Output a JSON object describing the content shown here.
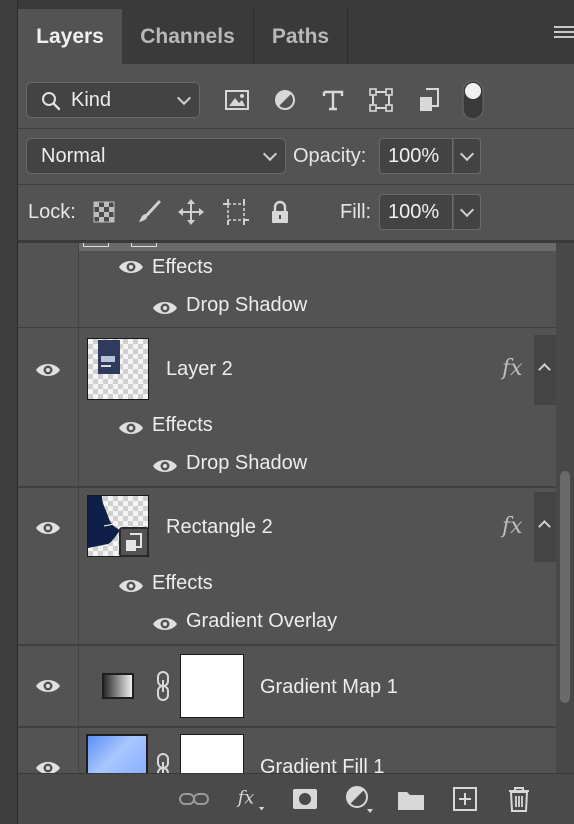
{
  "tabs": [
    {
      "label": "Layers",
      "active": true
    },
    {
      "label": "Channels",
      "active": false
    },
    {
      "label": "Paths",
      "active": false
    }
  ],
  "filter": {
    "label": "Kind"
  },
  "blend": {
    "mode": "Normal",
    "opacity_label": "Opacity:",
    "opacity_value": "100%"
  },
  "lock": {
    "label": "Lock:",
    "fill_label": "Fill:",
    "fill_value": "100%"
  },
  "layers": {
    "partial_top": {
      "effects_label": "Effects",
      "effect": "Drop Shadow"
    },
    "layer2": {
      "name": "Layer 2",
      "fx": "fx",
      "effects_label": "Effects",
      "effect": "Drop Shadow"
    },
    "rect2": {
      "name": "Rectangle 2",
      "fx": "fx",
      "effects_label": "Effects",
      "effect": "Gradient Overlay"
    },
    "gradmap": {
      "name": "Gradient Map 1"
    },
    "gradfill": {
      "name": "Gradient Fill 1"
    }
  },
  "bottom_icons": [
    "link-layers-icon",
    "add-style-icon",
    "add-mask-icon",
    "adjustment-layer-icon",
    "new-group-icon",
    "new-layer-icon",
    "delete-icon"
  ],
  "colors": {
    "panel": "#535353",
    "tabbar": "#3a3a3a",
    "text": "#e6e6e6",
    "thumb_navy": "#0e1f4a",
    "gradient_fill": "#8fb4ff"
  }
}
